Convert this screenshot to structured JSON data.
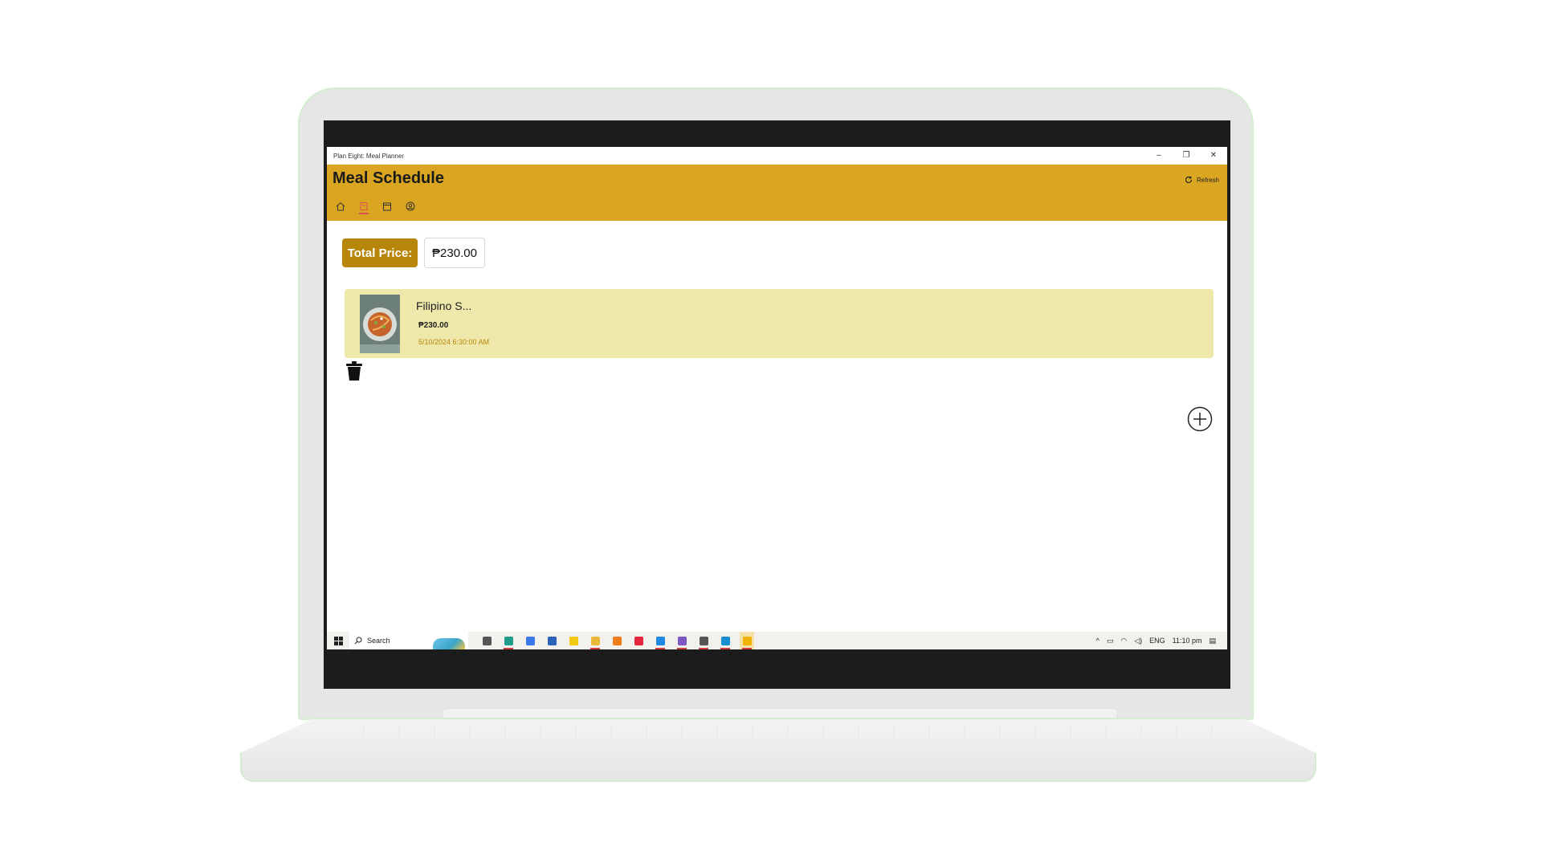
{
  "window": {
    "title": "Plan Eight: Meal Planner",
    "minimize_glyph": "–",
    "restore_glyph": "❐",
    "close_glyph": "✕"
  },
  "header": {
    "page_title": "Meal Schedule",
    "refresh_label": "Refresh",
    "background_color": "#daa520",
    "nav": [
      {
        "icon": "home-icon",
        "active": false
      },
      {
        "icon": "schedule-icon",
        "active": true
      },
      {
        "icon": "calendar-icon",
        "active": false
      },
      {
        "icon": "profile-icon",
        "active": false
      }
    ]
  },
  "summary": {
    "total_label": "Total Price:",
    "total_value": "₱230.00",
    "label_color": "#b8860b"
  },
  "meals": [
    {
      "name": "Filipino S...",
      "price": "₱230.00",
      "datetime": "5/10/2024 6:30:00 AM",
      "card_color": "#eee8aa"
    }
  ],
  "actions": {
    "delete_icon": "trash-icon",
    "add_icon": "add-circle-icon"
  },
  "taskbar": {
    "search_placeholder": "Search",
    "apps": [
      {
        "icon": "task-view-icon",
        "color": "#555555",
        "running": false
      },
      {
        "icon": "edge-icon",
        "color": "#1f9d8a",
        "running": true
      },
      {
        "icon": "chrome-icon",
        "color": "#3b78e7",
        "running": false
      },
      {
        "icon": "store-icon",
        "color": "#2a63b8",
        "running": false
      },
      {
        "icon": "notes-icon",
        "color": "#f2c811",
        "running": false
      },
      {
        "icon": "file-explorer-icon",
        "color": "#e9b93a",
        "running": true
      },
      {
        "icon": "vlc-icon",
        "color": "#ef7d1a",
        "running": false
      },
      {
        "icon": "opera-icon",
        "color": "#e3263b",
        "running": false
      },
      {
        "icon": "vscode-icon",
        "color": "#1e88e5",
        "running": true
      },
      {
        "icon": "visual-studio-icon",
        "color": "#7e57c2",
        "running": true
      },
      {
        "icon": "settings-icon",
        "color": "#555555",
        "running": true
      },
      {
        "icon": "edge-browser-icon",
        "color": "#1a8fcf",
        "running": true
      },
      {
        "icon": "meal-planner-icon",
        "color": "#f0b400",
        "running": true
      }
    ],
    "language": "ENG",
    "time": "11:10 pm"
  }
}
